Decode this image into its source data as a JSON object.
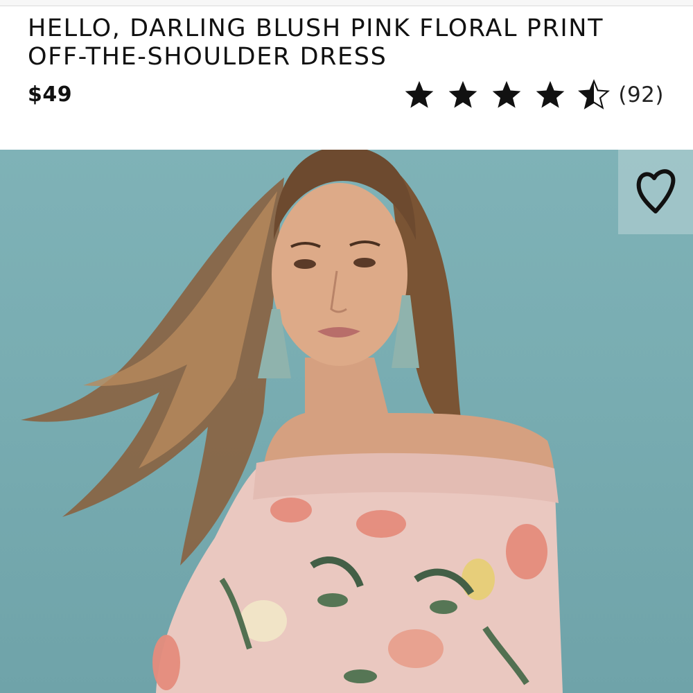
{
  "product": {
    "title": "HELLO, DARLING BLUSH PINK FLORAL PRINT OFF-THE-SHOULDER DRESS",
    "price": "$49",
    "rating": {
      "value": 4.5,
      "max": 5,
      "review_count": "(92)"
    }
  },
  "hero": {
    "background_color": "#7aaeb3",
    "wishlist_icon": "heart-outline-icon"
  },
  "colors": {
    "text": "#111111",
    "star": "#111111"
  }
}
